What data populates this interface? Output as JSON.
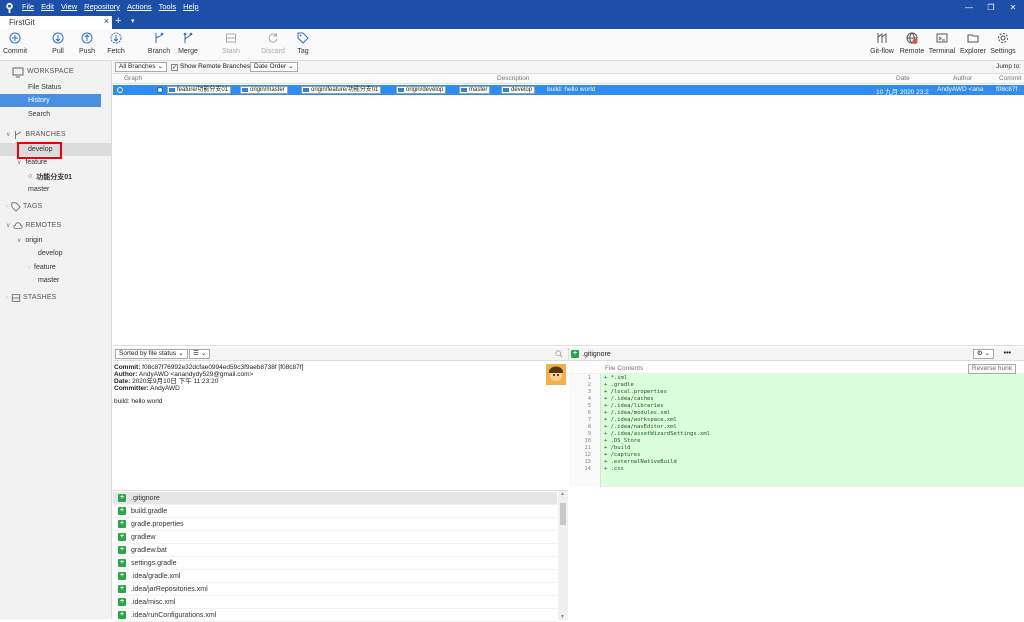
{
  "window": {
    "menu": [
      "File",
      "Edit",
      "View",
      "Repository",
      "Actions",
      "Tools",
      "Help"
    ],
    "controls": {
      "minimize": "—",
      "restore": "❐",
      "close": "✕"
    }
  },
  "tabs": {
    "active_label": "FirstGit",
    "close": "×",
    "add": "+",
    "dropdown": "▾"
  },
  "toolbar": {
    "commit": "Commit",
    "pull": "Pull",
    "push": "Push",
    "fetch": "Fetch",
    "branch": "Branch",
    "merge": "Merge",
    "stash": "Stash",
    "discard": "Discard",
    "tag": "Tag",
    "gitflow": "Git-flow",
    "remote": "Remote",
    "terminal": "Terminal",
    "explorer": "Explorer",
    "settings": "Settings",
    "remote_badge_color": "#e74c3c"
  },
  "sidebar": {
    "workspace": "WORKSPACE",
    "file_status": "File Status",
    "history": "History",
    "search": "Search",
    "branches": "BRANCHES",
    "develop": "develop",
    "feature": "feature",
    "feature_sub": "功能分支01",
    "master": "master",
    "tags": "TAGS",
    "remotes": "REMOTES",
    "origin": "origin",
    "origin_develop": "develop",
    "origin_feature": "feature",
    "origin_master": "master",
    "stashes": "STASHES"
  },
  "filterbar": {
    "branches_select": "All Branches",
    "show_remote": "Show Remote Branches",
    "order_select": "Date Order",
    "jump_to": "Jump to:"
  },
  "list_header": {
    "graph": "Graph",
    "description": "Description",
    "date": "Date",
    "author": "Author",
    "commit": "Commit"
  },
  "commit_row": {
    "refs": [
      "feature/功能分支01",
      "origin/master",
      "origin/feature/功能分支01",
      "origin/develop",
      "master",
      "develop"
    ],
    "message": "build: hello world",
    "date": "10 九月 2020 23:2",
    "author": "AndyAWD <ana",
    "hash": "f08c87f"
  },
  "lower_left": {
    "sort": "Sorted by file status",
    "view": "☰",
    "commit_label": "Commit:",
    "commit_value": "f08c87f76992e32dcfae0994ed59c3f9aeb8738f [f08c87f]",
    "author_label": "Author:",
    "author_value": "AndyAWD <anandydy529@gmail.com>",
    "date_label": "Date:",
    "date_value": "2020年9月10日 下午 11:23:20",
    "committer_label": "Committer:",
    "committer_value": "AndyAWD",
    "message": "build: hello world"
  },
  "files": [
    ".gitignore",
    "build.gradle",
    "gradle.properties",
    "gradlew",
    "gradlew.bat",
    "settings.gradle",
    ".idea/gradle.xml",
    ".idea/jarRepositories.xml",
    ".idea/misc.xml",
    ".idea/runConfigurations.xml"
  ],
  "diff": {
    "file": ".gitignore",
    "header": "File Contents",
    "reverse": "Reverse hunk",
    "more": "•••",
    "lines": [
      {
        "n": "1",
        "t": "+ *.iml"
      },
      {
        "n": "2",
        "t": "+ .gradle"
      },
      {
        "n": "3",
        "t": "+ /local.properties"
      },
      {
        "n": "4",
        "t": "+ /.idea/caches"
      },
      {
        "n": "5",
        "t": "+ /.idea/libraries"
      },
      {
        "n": "6",
        "t": "+ /.idea/modules.xml"
      },
      {
        "n": "7",
        "t": "+ /.idea/workspace.xml"
      },
      {
        "n": "8",
        "t": "+ /.idea/navEditor.xml"
      },
      {
        "n": "9",
        "t": "+ /.idea/assetWizardSettings.xml"
      },
      {
        "n": "10",
        "t": "+ .DS_Store"
      },
      {
        "n": "11",
        "t": "+ /build"
      },
      {
        "n": "12",
        "t": "+ /captures"
      },
      {
        "n": "13",
        "t": "+ .externalNativeBuild"
      },
      {
        "n": "14",
        "t": "+ .cxx"
      }
    ]
  }
}
